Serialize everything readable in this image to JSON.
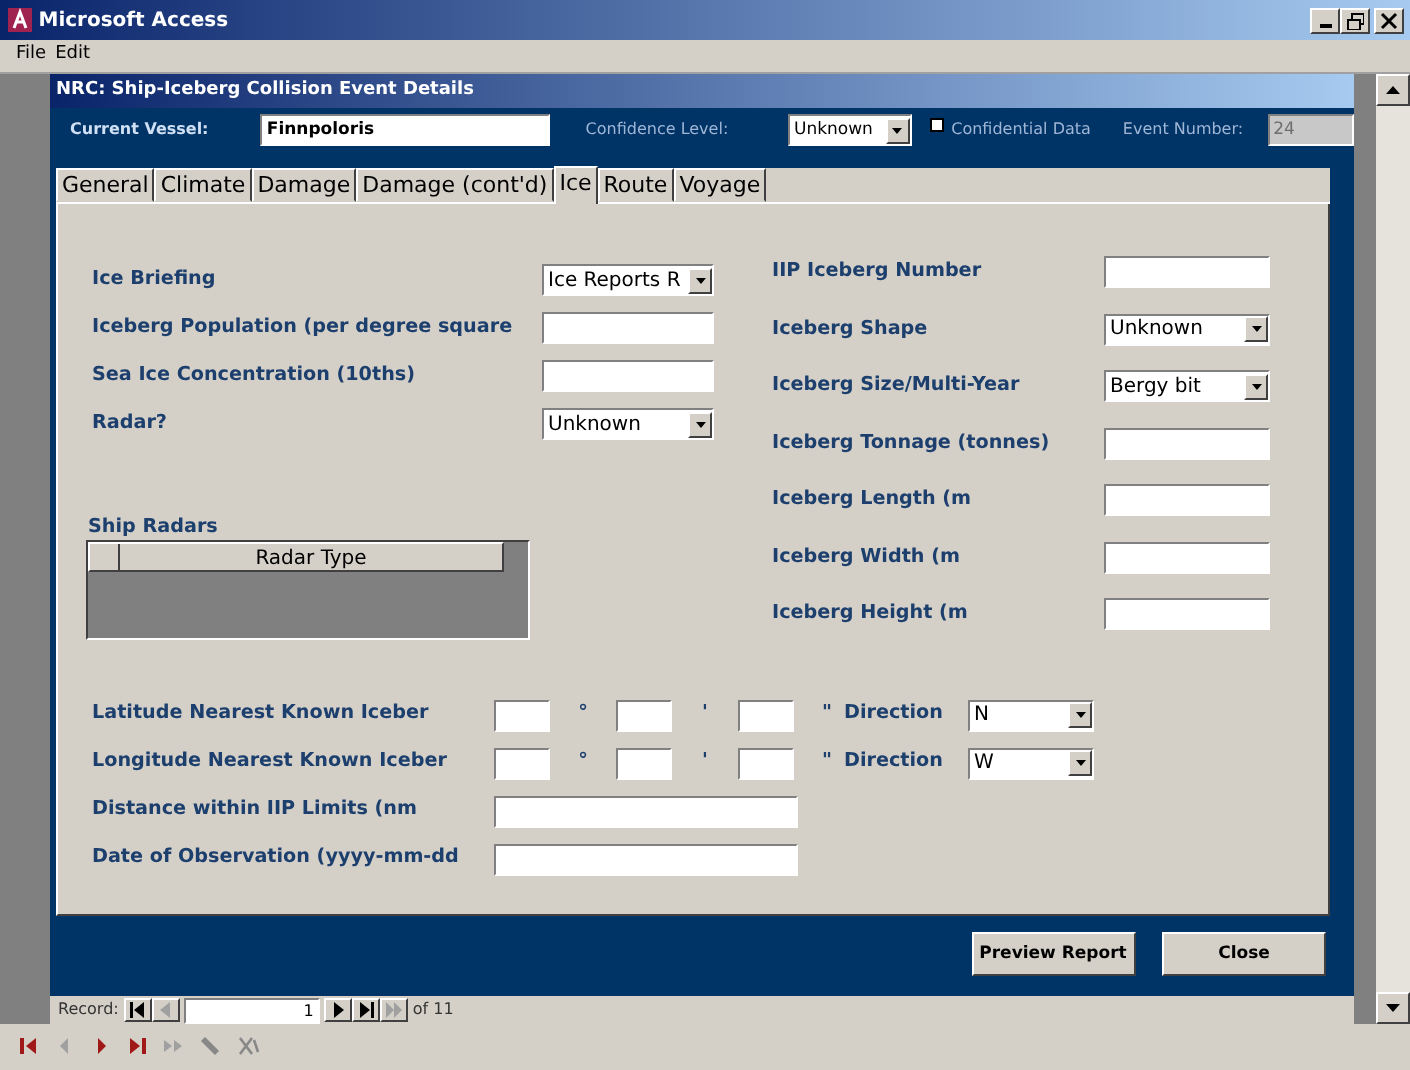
{
  "window": {
    "title": "Microsoft Access"
  },
  "menu": [
    "File",
    "Edit"
  ],
  "form": {
    "title": "NRC: Ship-Iceberg Collision Event Details",
    "header": {
      "vessel_label": "Current Vessel:",
      "vessel_value": "Finnpoloris",
      "confidence_label": "Confidence Level:",
      "confidence_value": "Unknown",
      "confidential": {
        "label": "Confidential Data",
        "checked": false
      },
      "event_label": "Event Number:",
      "event_value": "24",
      "event_disabled": true
    },
    "tabs": [
      {
        "label": "General",
        "selected": false
      },
      {
        "label": "Climate",
        "selected": false
      },
      {
        "label": "Damage",
        "selected": false
      },
      {
        "label": "Damage (cont'd)",
        "selected": false
      },
      {
        "label": "Ice",
        "selected": true
      },
      {
        "label": "Route",
        "selected": false
      },
      {
        "label": "Voyage",
        "selected": false
      }
    ],
    "left_fields": [
      {
        "label": "Ice Briefing",
        "kind": "combo",
        "value": "Ice Reports R"
      },
      {
        "label": "Iceberg Population (per degree square",
        "kind": "text"
      },
      {
        "label": "Sea Ice Concentration (10ths)",
        "kind": "text"
      },
      {
        "label": "Radar?",
        "kind": "combo",
        "value": "Unknown"
      }
    ],
    "right_fields": [
      {
        "label": "IIP Iceberg Number",
        "kind": "text"
      },
      {
        "label": "Iceberg Shape",
        "kind": "combo",
        "value": "Unknown"
      },
      {
        "label": "Iceberg Size/Multi-Year",
        "kind": "combo",
        "value": "Bergy bit"
      },
      {
        "label": "Iceberg Tonnage (tonnes)",
        "kind": "text"
      },
      {
        "label": "Iceberg Length (m",
        "kind": "text"
      },
      {
        "label": "Iceberg Width (m",
        "kind": "text"
      },
      {
        "label": "Iceberg Height (m",
        "kind": "text"
      }
    ],
    "subform": {
      "title": "Ship Radars",
      "columns": [
        "Radar Type"
      ]
    },
    "coordinates": [
      {
        "label": "Latitude Nearest Known Iceber",
        "units": [
          "°",
          "'",
          "\""
        ],
        "direction_label": "Direction",
        "direction": "N"
      },
      {
        "label": "Longitude Nearest Known Iceber",
        "units": [
          "°",
          "'",
          "\""
        ],
        "direction_label": "Direction",
        "direction": "W"
      }
    ],
    "bottom_fields": [
      {
        "label": "Distance within IIP Limits (nm",
        "kind": "text"
      },
      {
        "label": "Date of Observation (yyyy-mm-dd",
        "kind": "text"
      }
    ],
    "buttons": [
      "Preview Report",
      "Close"
    ],
    "record_nav": {
      "label": "Record:",
      "current": "1",
      "total": "of 11"
    }
  }
}
